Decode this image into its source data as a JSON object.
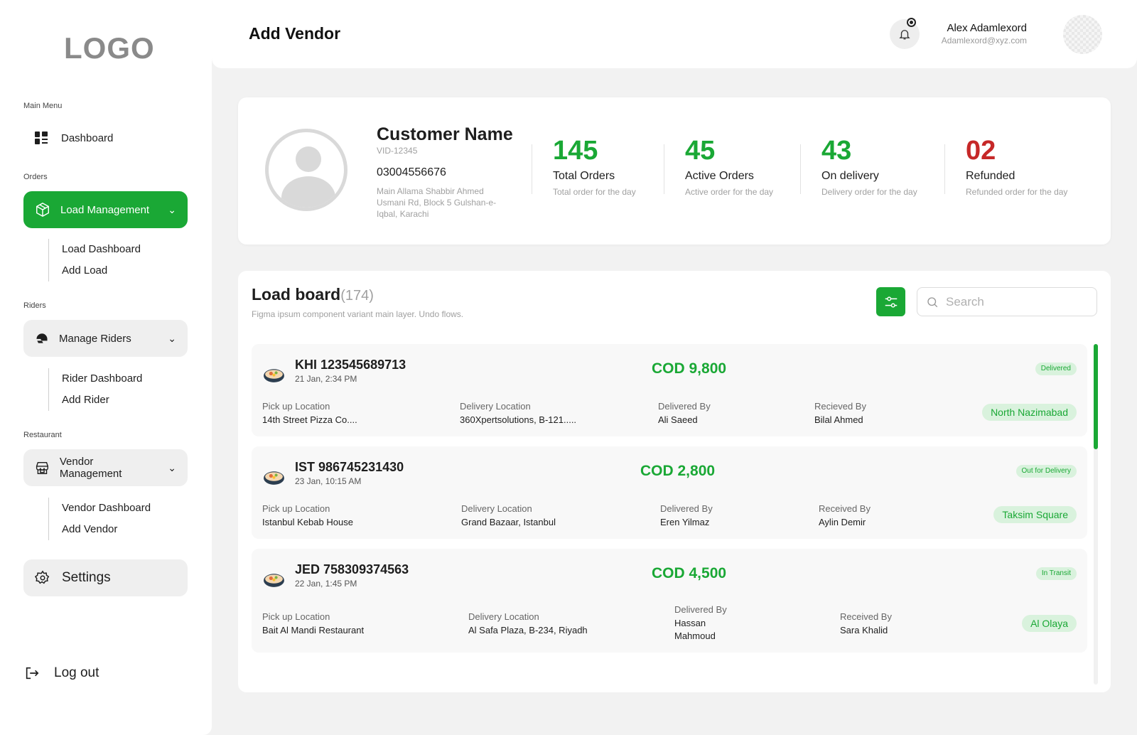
{
  "sidebar": {
    "logo": "LOGO",
    "main_menu_label": "Main Menu",
    "dashboard": "Dashboard",
    "orders_label": "Orders",
    "load_management": "Load Management",
    "load_sub": [
      "Load Dashboard",
      "Add Load"
    ],
    "riders_label": "Riders",
    "manage_riders": "Manage Riders",
    "riders_sub": [
      "Rider Dashboard",
      "Add Rider"
    ],
    "restaurant_label": "Restaurant",
    "vendor_management": "Vendor Management",
    "vendor_sub": [
      "Vendor Dashboard",
      "Add Vendor"
    ],
    "settings": "Settings",
    "logout": "Log out"
  },
  "header": {
    "title": "Add Vendor",
    "user_name": "Alex Adamlexord",
    "user_email": "Adamlexord@xyz.com"
  },
  "customer": {
    "name": "Customer Name",
    "id": "VID-12345",
    "phone": "03004556676",
    "address": "Main Allama Shabbir Ahmed Usmani Rd, Block 5 Gulshan-e-Iqbal, Karachi",
    "stats": [
      {
        "value": "145",
        "label": "Total Orders",
        "sub": "Total order for the day"
      },
      {
        "value": "45",
        "label": "Active Orders",
        "sub": "Active order for the day"
      },
      {
        "value": "43",
        "label": "On delivery",
        "sub": "Delivery order for the day"
      },
      {
        "value": "02",
        "label": "Refunded",
        "sub": "Refunded order for the day"
      }
    ]
  },
  "board": {
    "title": "Load board",
    "count": "(174)",
    "subtitle": "Figma ipsum component variant main layer. Undo flows.",
    "search_placeholder": "Search",
    "orders": [
      {
        "id": "KHI 123545689713",
        "date": "21 Jan, 2:34 PM",
        "cod": "COD 9,800",
        "status": "Delivered",
        "pickup_label": "Pick up Location",
        "pickup": "14th Street Pizza Co....",
        "delivery_label": "Delivery Location",
        "delivery": "360Xpertsolutions, B-121.....",
        "delivered_by_label": "Delivered By",
        "delivered_by": "Ali Saeed",
        "received_by_label": "Recieved By",
        "received_by": "Bilal Ahmed",
        "area": "North Nazimabad"
      },
      {
        "id": "IST 986745231430",
        "date": "23 Jan, 10:15 AM",
        "cod": "COD 2,800",
        "status": "Out for Delivery",
        "pickup_label": "Pick up Location",
        "pickup": "Istanbul Kebab House",
        "delivery_label": "Delivery Location",
        "delivery": "Grand Bazaar, Istanbul",
        "delivered_by_label": "Delivered By",
        "delivered_by": "Eren Yilmaz",
        "received_by_label": "Received By",
        "received_by": "Aylin Demir",
        "area": "Taksim Square"
      },
      {
        "id": "JED 758309374563",
        "date": "22 Jan, 1:45 PM",
        "cod": "COD 4,500",
        "status": "In Transit",
        "pickup_label": "Pick up Location",
        "pickup": "Bait Al Mandi Restaurant",
        "delivery_label": "Delivery Location",
        "delivery": "Al Safa Plaza, B-234, Riyadh",
        "delivered_by_label": "Delivered By",
        "delivered_by": "Hassan Mahmoud",
        "received_by_label": "Received By",
        "received_by": "Sara Khalid",
        "area": "Al Olaya"
      }
    ]
  },
  "colors": {
    "accent": "#1aa835",
    "refund": "#c62828",
    "badge_bg": "#d9f2dd"
  }
}
